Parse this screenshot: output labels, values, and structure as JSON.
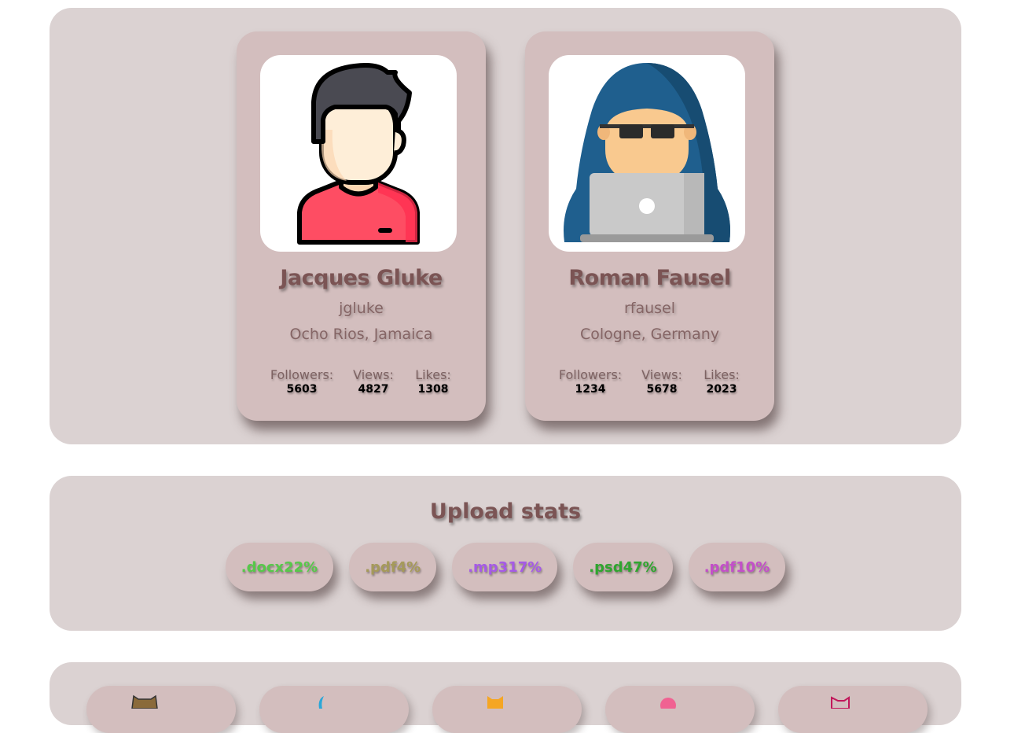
{
  "profiles": [
    {
      "name": "Jacques Gluke",
      "username": "jgluke",
      "location": "Ocho Rios, Jamaica",
      "avatar_icon": "person-avatar-icon",
      "stats": {
        "followers_label": "Followers:",
        "followers": "5603",
        "views_label": "Views:",
        "views": "4827",
        "likes_label": "Likes:",
        "likes": "1308"
      }
    },
    {
      "name": "Roman Fausel",
      "username": "rfausel",
      "location": "Cologne, Germany",
      "avatar_icon": "hacker-avatar-icon",
      "stats": {
        "followers_label": "Followers:",
        "followers": "1234",
        "views_label": "Views:",
        "views": "5678",
        "likes_label": "Likes:",
        "likes": "2023"
      }
    }
  ],
  "upload_stats": {
    "title": "Upload stats",
    "items": [
      {
        "text": ".docx22%",
        "color": "#57c84a"
      },
      {
        "text": ".pdf4%",
        "color": "#a59a5a"
      },
      {
        "text": ".mp317%",
        "color": "#a55ae6"
      },
      {
        "text": ".psd47%",
        "color": "#2fa52f"
      },
      {
        "text": ".pdf10%",
        "color": "#c34fc9"
      }
    ]
  },
  "bottom_cards": {
    "icons": [
      "owl-icon",
      "bird-icon",
      "fox-icon",
      "flower-icon",
      "bat-icon"
    ]
  },
  "colors": {
    "panel": "#dbd2d2",
    "card": "#d3bebe",
    "heading": "#7b5454"
  }
}
